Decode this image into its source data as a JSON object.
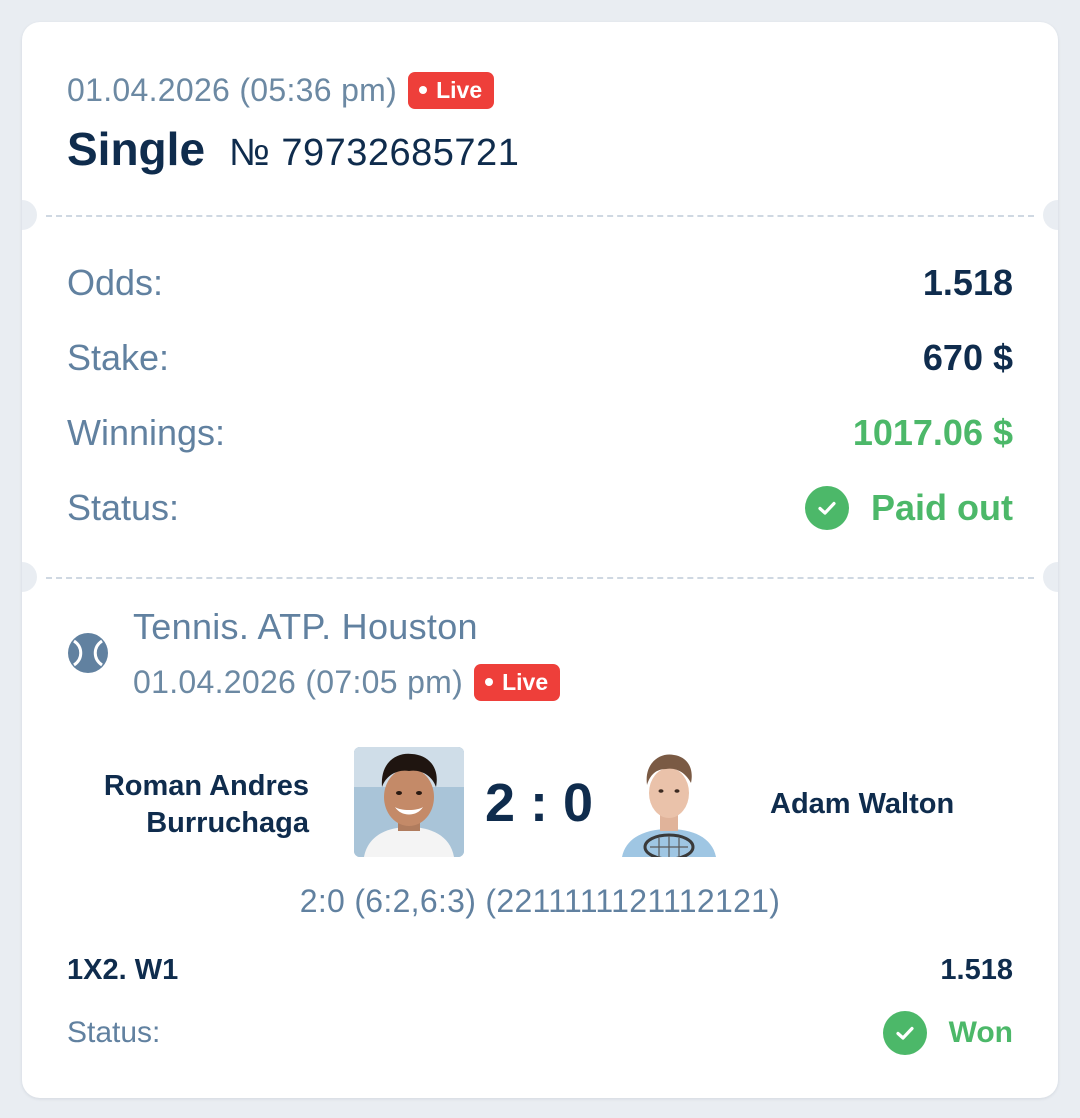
{
  "header": {
    "datetime": "01.04.2026 (05:36 pm)",
    "live_label": "Live",
    "bet_type": "Single",
    "bet_number": "№ 79732685721"
  },
  "summary": {
    "odds_label": "Odds:",
    "odds_value": "1.518",
    "stake_label": "Stake:",
    "stake_value": "670 $",
    "winnings_label": "Winnings:",
    "winnings_value": "1017.06 $",
    "status_label": "Status:",
    "status_value": "Paid out",
    "status_icon": "check-circle-icon"
  },
  "event": {
    "sport_icon": "tennis-ball-icon",
    "title": "Tennis. ATP. Houston",
    "datetime": "01.04.2026 (07:05 pm)",
    "live_label": "Live",
    "team1": {
      "name_line1": "Roman Andres",
      "name_line2": "Burruchaga"
    },
    "team2": {
      "name": "Adam Walton"
    },
    "score": "2 : 0",
    "score_detail": "2:0 (6:2,6:3) (2211111121112121)"
  },
  "selection": {
    "market": "1X2. W1",
    "odds": "1.518",
    "status_label": "Status:",
    "status_value": "Won"
  },
  "colors": {
    "primary_text": "#0f2c4d",
    "muted_text": "#6181a0",
    "success": "#4cb869",
    "live": "#ee3f3a",
    "background": "#e9edf2"
  }
}
